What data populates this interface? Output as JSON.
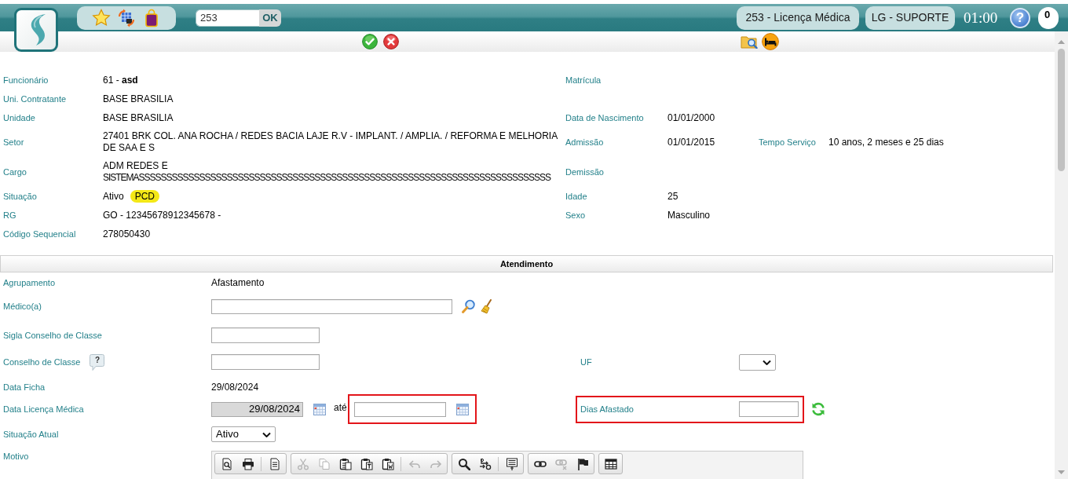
{
  "header": {
    "search": {
      "value": "253",
      "button": "OK"
    },
    "screen_button": "253 - Licença Médica",
    "user_button": "LG - SUPORTE",
    "session_timer": "01:00",
    "help_button": "?",
    "notifications": "0"
  },
  "employee": [
    {
      "label": "Funcionário",
      "value": "61 - **asd**",
      "side": [
        {
          "label": "Matrícula"
        }
      ]
    },
    {
      "label": "Uni. Contratante",
      "value": "BASE BRASILIA"
    },
    {
      "label": "Unidade",
      "value": "BASE BRASILIA",
      "side": [
        {
          "label": "Data de Nascimento",
          "value": "01/01/2000"
        }
      ]
    },
    {
      "label": "Setor",
      "value": "27401 BRK COL. ANA ROCHA / REDES BACIA LAJE R.V - IMPLANT. / AMPLIA. / REFORMA E MELHORIA DE SAA E S",
      "side": [
        {
          "label": "Admissão",
          "value": "01/01/2015"
        },
        {
          "label": "Tempo Serviço",
          "value": "10 anos, 2 meses e 25 dias"
        }
      ]
    },
    {
      "label": "Cargo",
      "value": "ADM REDES E SISTEMASSSSSSSSSSSSSSSSSSSSSSSSSSSSSSSSSSSSSSSSSSSSSSSSSSSSSSSSSSSSSSSSSSSSSSSSSSS",
      "side": [
        {
          "label": "Demissão"
        }
      ]
    },
    {
      "label": "Situação",
      "value": "Ativo",
      "badge": "PCD",
      "side": [
        {
          "label": "Idade",
          "value": "25"
        }
      ]
    },
    {
      "label": "RG",
      "value": "GO - 12345678912345678 -",
      "side": [
        {
          "label": "Sexo",
          "value": "Masculino"
        }
      ]
    },
    {
      "label": "Código Sequencial",
      "value": "278050430"
    }
  ],
  "attendance": {
    "title": "Atendimento",
    "fields": [
      {
        "kind": "static",
        "label": "Agrupamento",
        "value": "Afastamento"
      },
      {
        "kind": "lookup",
        "label": "Médico(a)"
      },
      {
        "kind": "input",
        "label": "Sigla Conselho de Classe"
      },
      {
        "kind": "input",
        "label": "Conselho de Classe",
        "help": "?",
        "side": {
          "kind": "select",
          "label": "UF",
          "highlighted": false
        }
      },
      {
        "kind": "static",
        "label": "Data Ficha",
        "value": "29/08/2024"
      },
      {
        "kind": "date_range",
        "label": "Data Licença Médica",
        "start": {
          "value": "29/08/2024",
          "disabled": true,
          "highlighted": false
        },
        "separator": "até",
        "end": {
          "disabled": false,
          "highlighted": true
        },
        "side": {
          "kind": "computed",
          "label": "Dias Afastado",
          "highlighted": true
        }
      },
      {
        "kind": "select",
        "label": "Situação Atual",
        "value": "Ativo"
      },
      {
        "kind": "editor",
        "label": "Motivo",
        "toolbar": [
          [
            {
              "kind": "preview",
              "disabled": false
            },
            {
              "kind": "print",
              "disabled": false
            },
            {
              "kind": "separator"
            },
            {
              "kind": "template",
              "disabled": false
            }
          ],
          [
            {
              "kind": "cut",
              "disabled": true
            },
            {
              "kind": "copy",
              "disabled": true
            },
            {
              "kind": "paste",
              "disabled": false
            },
            {
              "kind": "paste_text",
              "disabled": false
            },
            {
              "kind": "paste_word",
              "disabled": false
            },
            {
              "kind": "separator"
            },
            {
              "kind": "undo",
              "disabled": true
            },
            {
              "kind": "redo",
              "disabled": true
            }
          ],
          [
            {
              "kind": "find",
              "disabled": false
            },
            {
              "kind": "replace",
              "disabled": false
            },
            {
              "kind": "separator"
            },
            {
              "kind": "blocks",
              "disabled": false
            }
          ],
          [
            {
              "kind": "link",
              "disabled": false
            },
            {
              "kind": "unlink",
              "disabled": true
            },
            {
              "kind": "anchor",
              "disabled": false
            }
          ],
          [
            {
              "kind": "table",
              "disabled": false
            }
          ]
        ]
      }
    ]
  }
}
